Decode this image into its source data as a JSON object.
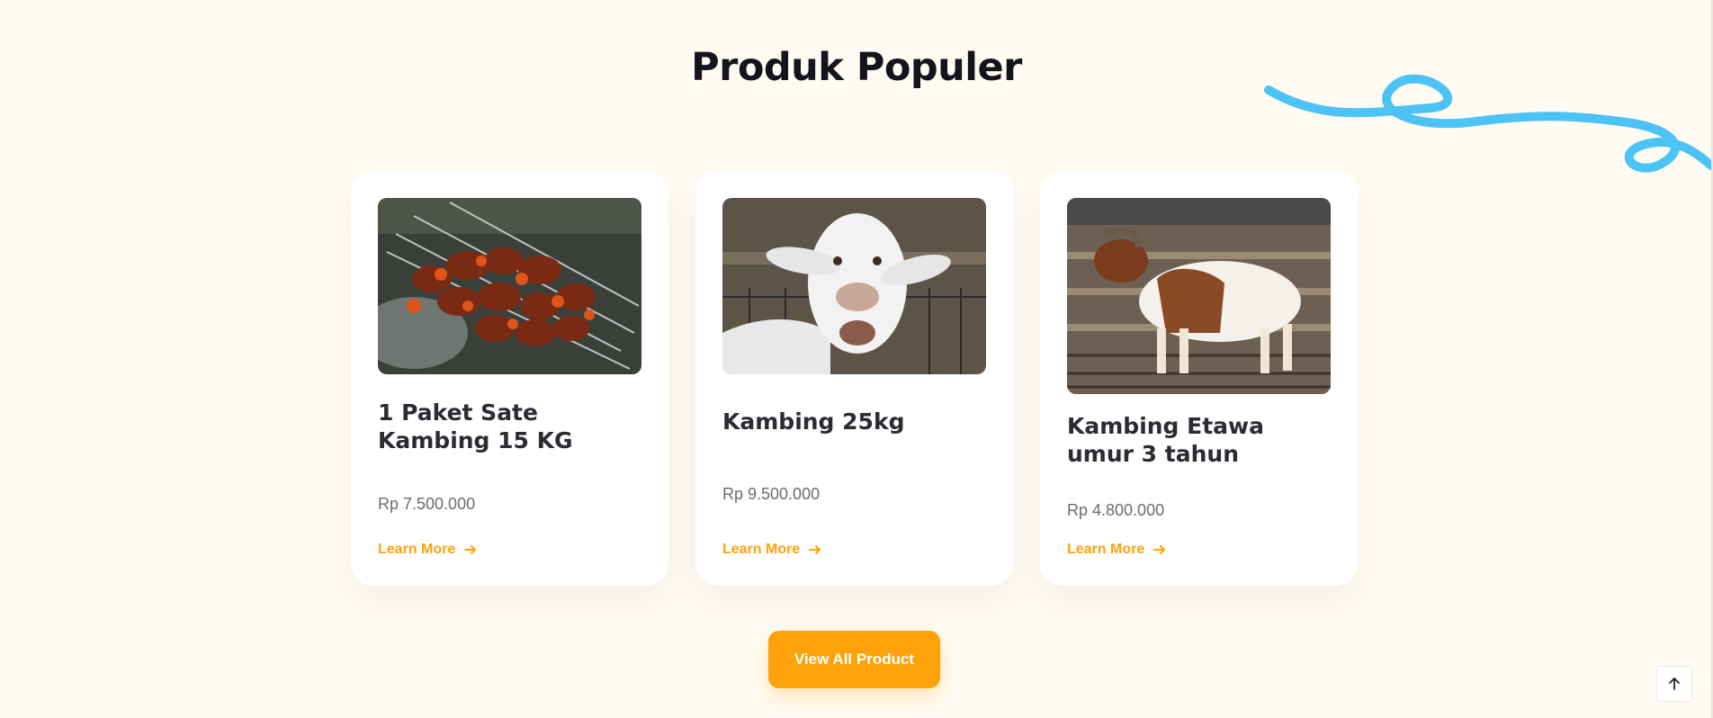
{
  "section": {
    "title": "Produk Populer"
  },
  "products": [
    {
      "title": "1 Paket Sate Kambing 15 KG",
      "price": "Rp 7.500.000",
      "link_label": "Learn More",
      "image": "skewers-photo"
    },
    {
      "title": "Kambing 25kg",
      "price": "Rp 9.500.000",
      "link_label": "Learn More",
      "image": "goat-face-photo"
    },
    {
      "title": "Kambing Etawa umur 3 tahun",
      "price": "Rp 4.800.000",
      "link_label": "Learn More",
      "image": "etawa-goat-photo"
    }
  ],
  "actions": {
    "view_all_label": "View All Product"
  },
  "icons": {
    "card_link_arrow": "arrow-right-icon",
    "scroll_top": "arrow-up-icon",
    "decoration": "squiggle-decoration"
  },
  "colors": {
    "accent": "#fea20a",
    "background": "#fffbf2",
    "squiggle": "#4cc3f5",
    "title": "#14141c"
  }
}
